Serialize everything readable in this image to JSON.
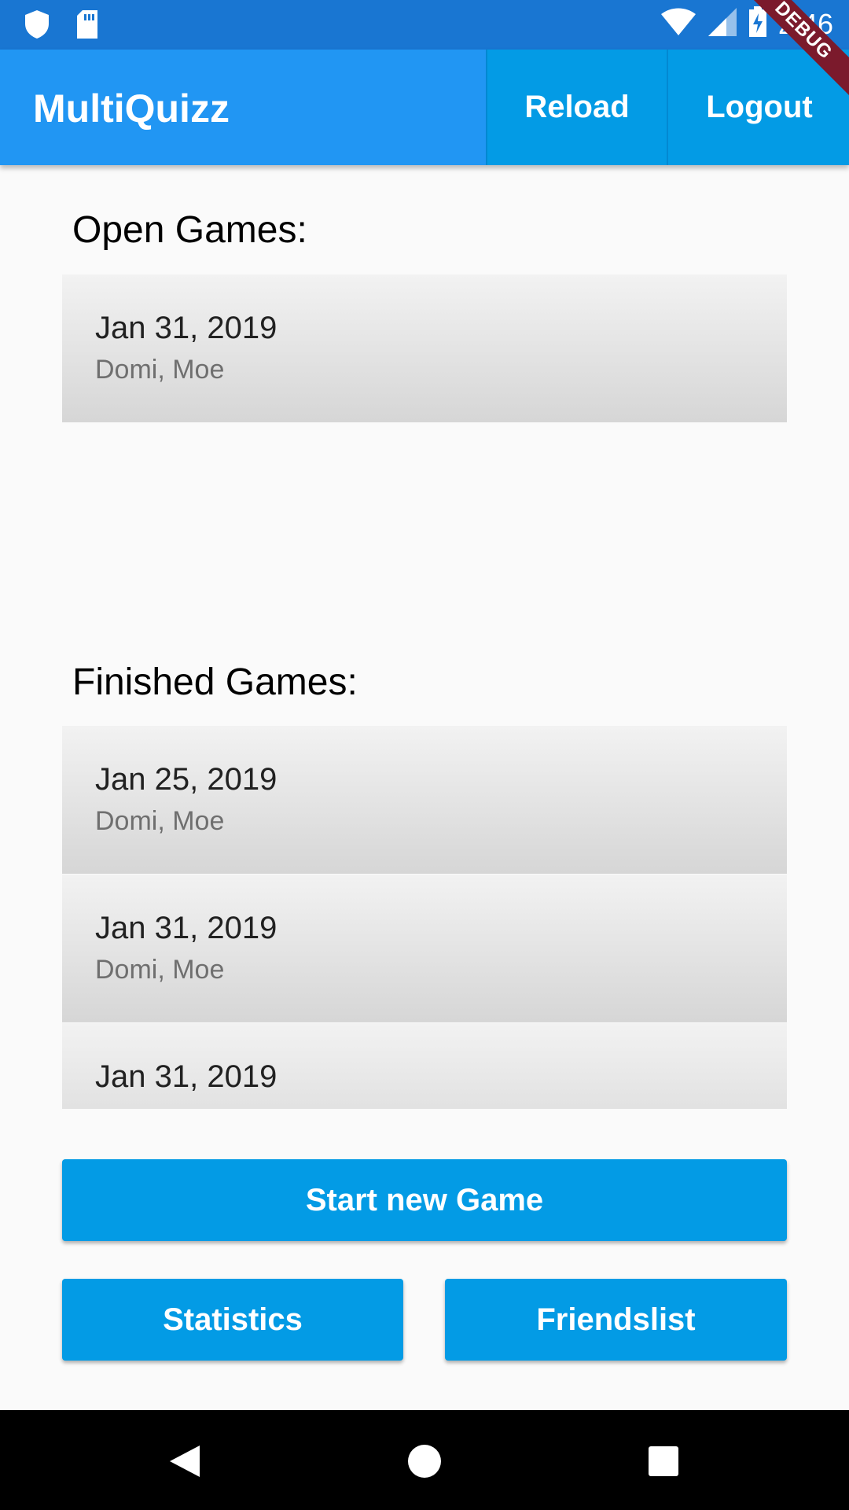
{
  "status_bar": {
    "time": "2:46",
    "icons": [
      "shield-icon",
      "sd-card-icon",
      "wifi-icon",
      "signal-icon",
      "battery-charging-icon"
    ]
  },
  "app_bar": {
    "title": "MultiQuizz",
    "actions": {
      "reload": "Reload",
      "logout": "Logout"
    },
    "debug_label": "DEBUG",
    "color": "#2196f3",
    "action_color": "#039be5"
  },
  "open_games": {
    "title": "Open Games:",
    "items": [
      {
        "date": "Jan 31, 2019",
        "players": "Domi, Moe"
      }
    ]
  },
  "finished_games": {
    "title": "Finished Games:",
    "items": [
      {
        "date": "Jan 25, 2019",
        "players": "Domi, Moe"
      },
      {
        "date": "Jan 31, 2019",
        "players": "Domi, Moe"
      },
      {
        "date": "Jan 31, 2019",
        "players": ""
      }
    ]
  },
  "buttons": {
    "start_new_game": "Start new Game",
    "statistics": "Statistics",
    "friendslist": "Friendslist"
  },
  "nav_bar": {
    "icons": [
      "back-icon",
      "home-icon",
      "recents-icon"
    ]
  }
}
